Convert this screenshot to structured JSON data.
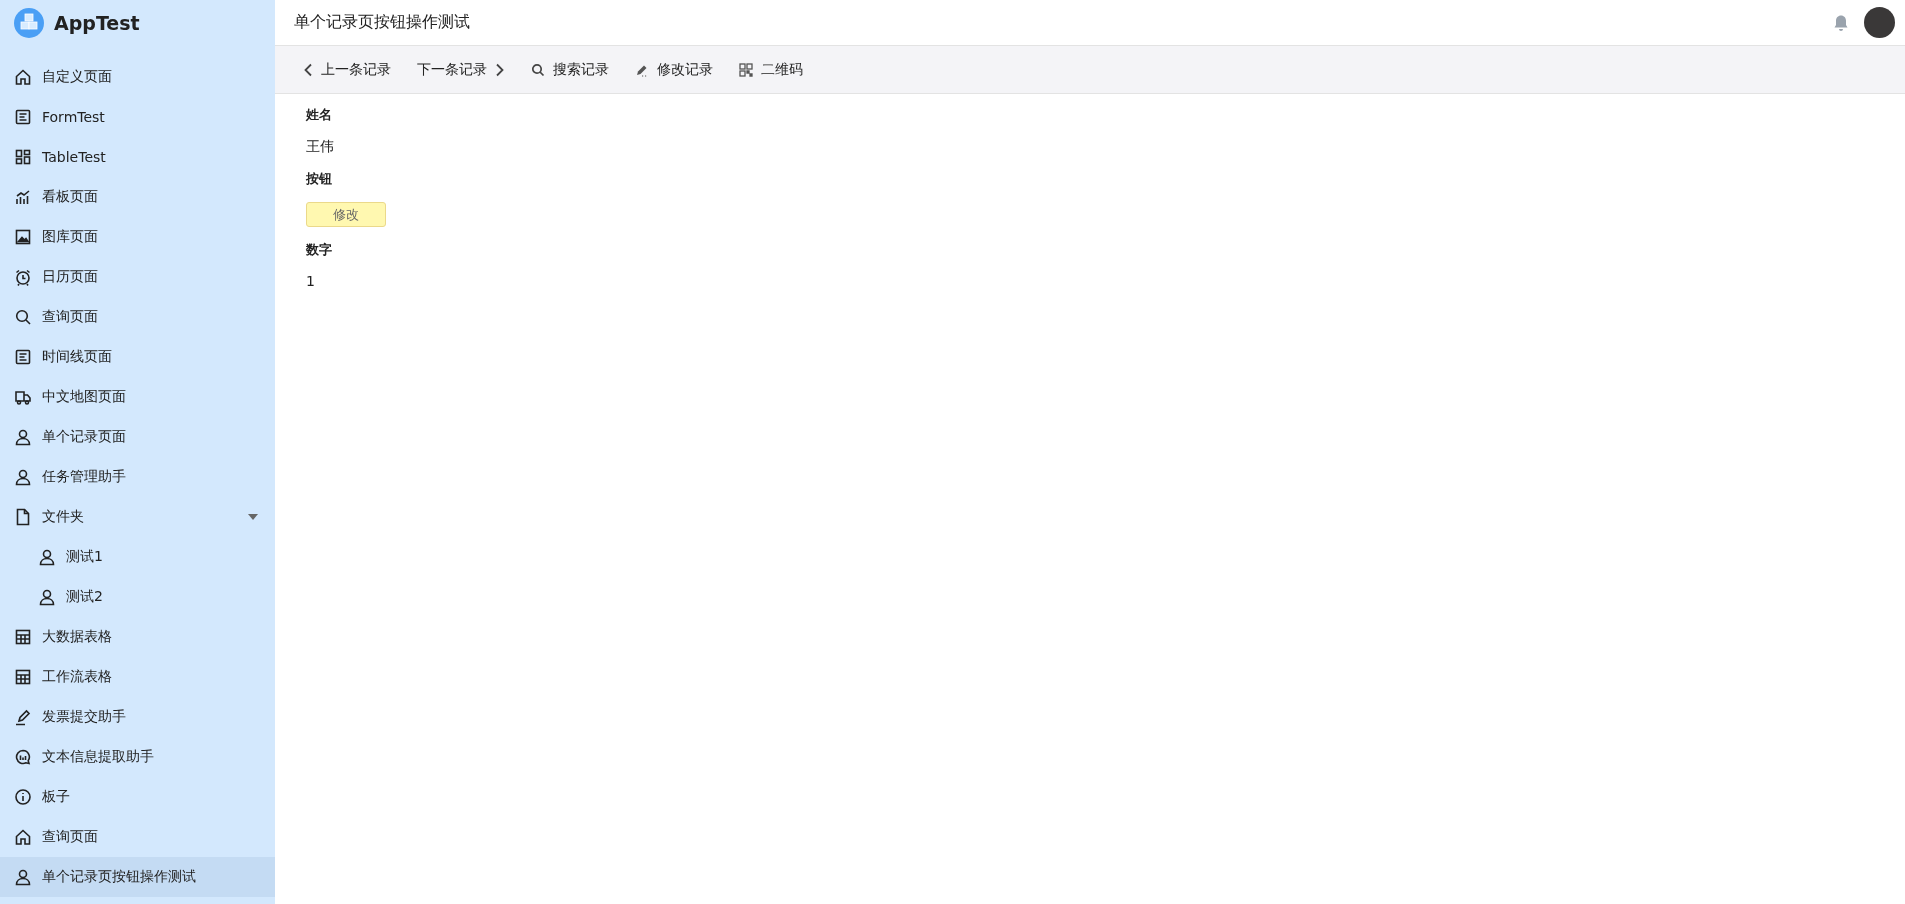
{
  "app": {
    "name": "AppTest"
  },
  "sidebar": {
    "items": [
      {
        "label": "自定义页面",
        "selected": false
      },
      {
        "label": "FormTest",
        "selected": false
      },
      {
        "label": "TableTest",
        "selected": false
      },
      {
        "label": "看板页面",
        "selected": false
      },
      {
        "label": "图库页面",
        "selected": false
      },
      {
        "label": "日历页面",
        "selected": false
      },
      {
        "label": "查询页面",
        "selected": false
      },
      {
        "label": "时间线页面",
        "selected": false
      },
      {
        "label": "中文地图页面",
        "selected": false
      },
      {
        "label": "单个记录页面",
        "selected": false
      },
      {
        "label": "任务管理助手",
        "selected": false
      },
      {
        "label": "文件夹",
        "selected": false,
        "expanded": true,
        "children": [
          {
            "label": "测试1",
            "selected": false
          },
          {
            "label": "测试2",
            "selected": false
          }
        ]
      },
      {
        "label": "大数据表格",
        "selected": false
      },
      {
        "label": "工作流表格",
        "selected": false
      },
      {
        "label": "发票提交助手",
        "selected": false
      },
      {
        "label": "文本信息提取助手",
        "selected": false
      },
      {
        "label": "板子",
        "selected": false
      },
      {
        "label": "查询页面",
        "selected": false
      },
      {
        "label": "单个记录页按钮操作测试",
        "selected": true
      }
    ]
  },
  "header": {
    "title": "单个记录页按钮操作测试"
  },
  "toolbar": [
    {
      "label": "上一条记录"
    },
    {
      "label": "下一条记录"
    },
    {
      "label": "搜索记录"
    },
    {
      "label": "修改记录"
    },
    {
      "label": "二维码"
    }
  ],
  "fields": [
    {
      "kind": "text",
      "label": "姓名",
      "value": "王伟"
    },
    {
      "kind": "button",
      "label": "按钮",
      "value": "修改"
    },
    {
      "kind": "text",
      "label": "数字",
      "value": "1"
    }
  ]
}
